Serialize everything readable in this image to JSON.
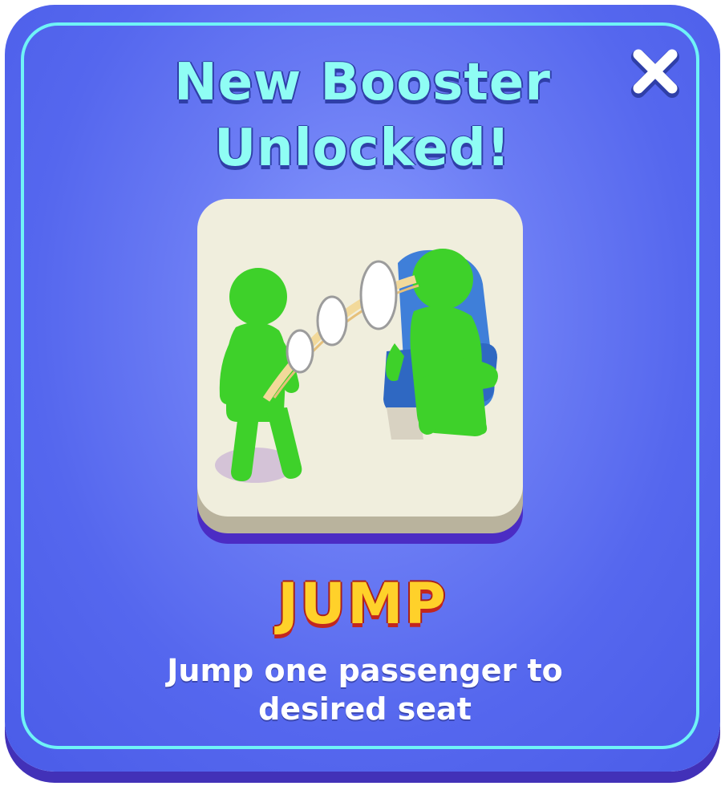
{
  "popup": {
    "title_line1": "New Booster",
    "title_line2": "Unlocked!",
    "booster_name": "JUMP",
    "description": "Jump one passenger to desired seat",
    "close_icon": "close-x-icon",
    "illustration": "jump-booster-illustration"
  },
  "colors": {
    "panel": "#5567ee",
    "panel_border": "#6ff3f7",
    "title": "#8ffdf4",
    "booster_name": "#ffd12a",
    "booster_name_outline": "#c2261e",
    "card_face": "#f0eedd",
    "character": "#3ed12a"
  }
}
